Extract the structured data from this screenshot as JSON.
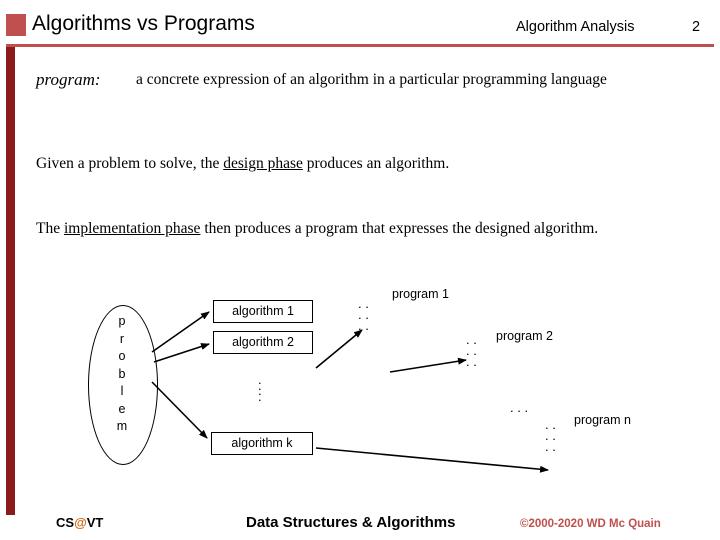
{
  "header": {
    "title": "Algorithms vs Programs",
    "subject": "Algorithm Analysis",
    "page_number": "2",
    "accent_color": "#c0504d"
  },
  "definition": {
    "term": "program:",
    "text": "a concrete expression of an algorithm in a particular programming language"
  },
  "paragraphs": {
    "first_pre": "Given a problem to solve, the ",
    "first_underlined": "design phase",
    "first_post": " produces an algorithm.",
    "second_pre": "The ",
    "second_underlined": "implementation phase",
    "second_post": " then produces a program that expresses the designed algorithm."
  },
  "diagram": {
    "problem_label": "problem",
    "problem_letters": [
      "p",
      "r",
      "o",
      "b",
      "l",
      "e",
      "m"
    ],
    "algorithm_1": "algorithm 1",
    "algorithm_2": "algorithm 2",
    "algorithm_k": "algorithm k",
    "algorithms_ellipsis": "⋮",
    "program_1": "program 1",
    "program_2": "program 2",
    "program_n": "program n",
    "program_dots": ". .\n. .\n. .",
    "diagonal_ellipsis": "."
  },
  "footer": {
    "left_prefix": "CS",
    "left_at": "@",
    "left_suffix": "VT",
    "center": "Data Structures & Algorithms",
    "right": "©2000-2020 WD Mc Quain"
  }
}
